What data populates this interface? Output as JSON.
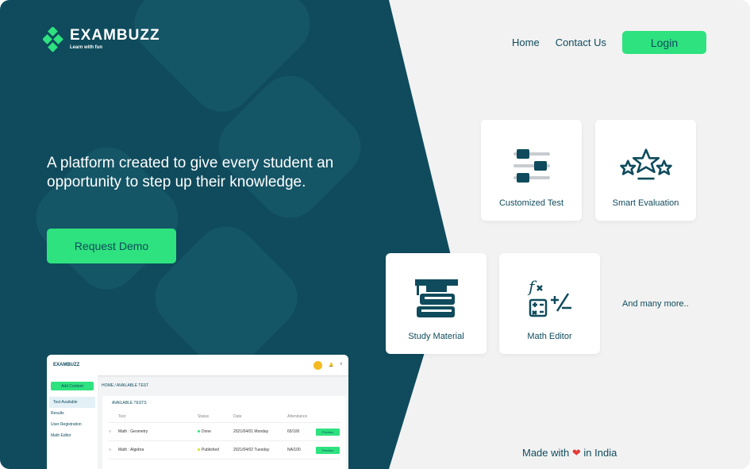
{
  "brand": {
    "name": "EXAMBUZZ",
    "tagline": "Learn with fun"
  },
  "nav": {
    "home": "Home",
    "contact": "Contact Us",
    "login": "Login"
  },
  "hero": {
    "text": "A platform created to give every student an opportunity to step up their knowledge.",
    "cta": "Request Demo"
  },
  "features": [
    {
      "label": "Customized Test",
      "icon": "sliders-icon"
    },
    {
      "label": "Smart Evaluation",
      "icon": "stars-icon"
    },
    {
      "label": "Study Material",
      "icon": "books-icon"
    },
    {
      "label": "Math Editor",
      "icon": "math-icon"
    }
  ],
  "more": "And many more..",
  "footer": {
    "made": "Made with",
    "heart": "❤",
    "country": "in India"
  },
  "dashboard": {
    "brand": "EXAMBUZZ",
    "add": "Add Content",
    "sidebar": [
      "Test Available",
      "Results",
      "User Registration",
      "Math Editor"
    ],
    "breadcrumb": "HOME / AVAILABLE TEST",
    "panel_title": "AVAILABLE TESTS",
    "columns": [
      "Test",
      "Status",
      "Date",
      "Attendance"
    ],
    "rows": [
      {
        "test": "Math : Geometry",
        "status": "Done",
        "date": "2021/04/01 Monday",
        "att": "65/100",
        "btn": "Preview"
      },
      {
        "test": "Math : Algebra",
        "status": "Published",
        "date": "2021/04/02 Tuesday",
        "att": "NA/100",
        "btn": "Preview"
      }
    ]
  },
  "colors": {
    "dark": "#0f4b5c",
    "accent": "#2ee27f",
    "light": "#f2f2f2"
  }
}
